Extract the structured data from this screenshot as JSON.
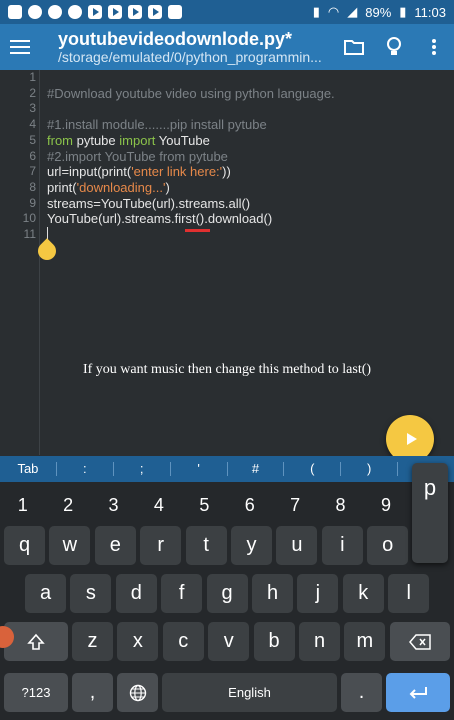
{
  "status_bar": {
    "battery": "89%",
    "time": "11:03"
  },
  "app_bar": {
    "title": "youtubevideodownlode.py*",
    "subtitle": "/storage/emulated/0/python_programmin..."
  },
  "editor": {
    "lines": [
      {
        "num": "1",
        "parts": []
      },
      {
        "num": "2",
        "parts": [
          {
            "t": "#Download youtube video using python language.",
            "c": "comment"
          }
        ]
      },
      {
        "num": "3",
        "parts": []
      },
      {
        "num": "4",
        "parts": [
          {
            "t": "#1.install module.......pip install pytube",
            "c": "comment"
          }
        ]
      },
      {
        "num": "5",
        "parts": [
          {
            "t": "from",
            "c": "kw"
          },
          {
            "t": " pytube ",
            "c": "plain"
          },
          {
            "t": "import",
            "c": "kw"
          },
          {
            "t": " YouTube",
            "c": "plain"
          }
        ]
      },
      {
        "num": "6",
        "parts": [
          {
            "t": "#2.import YouTube from pytube",
            "c": "comment"
          }
        ]
      },
      {
        "num": "7",
        "parts": [
          {
            "t": "url=input(print(",
            "c": "plain"
          },
          {
            "t": "'enter link here:'",
            "c": "str"
          },
          {
            "t": "))",
            "c": "plain"
          }
        ]
      },
      {
        "num": "8",
        "parts": [
          {
            "t": "print(",
            "c": "plain"
          },
          {
            "t": "'downloading...'",
            "c": "str"
          },
          {
            "t": ")",
            "c": "plain"
          }
        ]
      },
      {
        "num": "9",
        "parts": [
          {
            "t": "streams=YouTube(url).streams.all()",
            "c": "plain"
          }
        ]
      },
      {
        "num": "10",
        "parts": [
          {
            "t": "YouTube(url).streams.first().download()",
            "c": "plain"
          }
        ]
      },
      {
        "num": "11",
        "parts": []
      }
    ]
  },
  "caption": "If you want music then change this method to last()",
  "symbol_bar": [
    "Tab",
    ":",
    ";",
    "'",
    "#",
    "(",
    ")",
    "."
  ],
  "keyboard": {
    "numbers": [
      "1",
      "2",
      "3",
      "4",
      "5",
      "6",
      "7",
      "8",
      "9",
      "0"
    ],
    "row1": [
      "q",
      "w",
      "e",
      "r",
      "t",
      "y",
      "u",
      "i",
      "o"
    ],
    "row2": [
      "a",
      "s",
      "d",
      "f",
      "g",
      "h",
      "j",
      "k",
      "l"
    ],
    "row3": [
      "z",
      "x",
      "c",
      "v",
      "b",
      "n",
      "m"
    ],
    "popup_key": "p",
    "sym_key": "?123",
    "comma_key": ",",
    "space_label": "English",
    "period_key": "."
  },
  "colors": {
    "appbar": "#2b79b5",
    "statusbar": "#1f5f93",
    "fab": "#f5c842",
    "enter": "#5b9ee8"
  }
}
